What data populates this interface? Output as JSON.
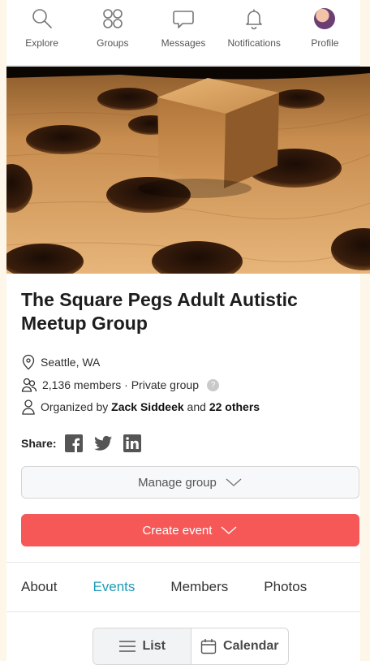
{
  "nav": {
    "items": [
      {
        "label": "Explore",
        "icon": "search-icon"
      },
      {
        "label": "Groups",
        "icon": "groups-icon"
      },
      {
        "label": "Messages",
        "icon": "message-icon"
      },
      {
        "label": "Notifications",
        "icon": "bell-icon"
      },
      {
        "label": "Profile",
        "icon": "avatar"
      }
    ]
  },
  "group": {
    "title": "The Square Pegs Adult Autistic Meetup Group",
    "location": "Seattle, WA",
    "members_text": "2,136 members · Private group",
    "organized_prefix": "Organized by ",
    "organizer": "Zack Siddeek",
    "organized_and": " and ",
    "others": "22 others",
    "help_glyph": "?"
  },
  "share": {
    "label": "Share:",
    "networks": [
      "facebook-icon",
      "twitter-icon",
      "linkedin-icon"
    ]
  },
  "buttons": {
    "manage": "Manage group",
    "create": "Create event"
  },
  "tabs": [
    "About",
    "Events",
    "Members",
    "Photos"
  ],
  "active_tab": "Events",
  "view_toggle": {
    "list": "List",
    "calendar": "Calendar",
    "selected": "List"
  },
  "colors": {
    "accent_teal": "#1c9bb8",
    "create_red": "#f65858"
  }
}
